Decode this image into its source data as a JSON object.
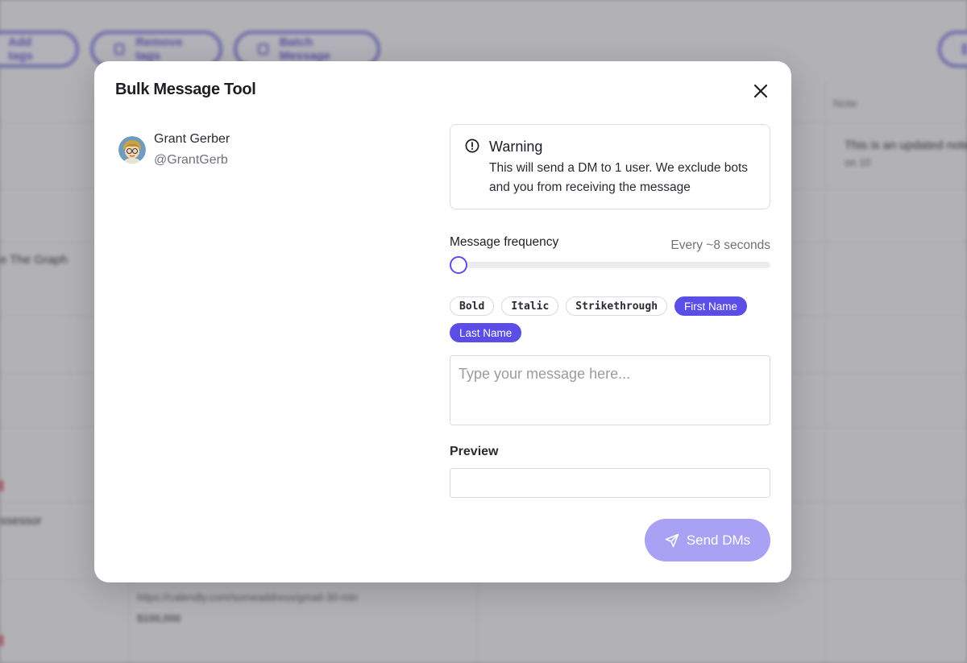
{
  "background": {
    "toolbar": [
      "Add tags",
      "Remove tags",
      "Batch Message"
    ],
    "header_col": "Note",
    "cells": {
      "note_text": "This is an updated note",
      "note_sub": "on 10",
      "row_graph": "e The Graph",
      "row_other": "ssessor",
      "link": "https://calendly.com/someaddress/gmail-30-min",
      "link_sub": "$100,000"
    }
  },
  "modal": {
    "title": "Bulk Message Tool",
    "user": {
      "name": "Grant Gerber",
      "handle": "@GrantGerb"
    },
    "warning": {
      "title": "Warning",
      "body": "This will send a DM to 1 user. We exclude bots and you from receiving the message"
    },
    "frequency": {
      "label": "Message frequency",
      "value_text": "Every ~8 seconds",
      "slider_fraction": 0.0
    },
    "chips": [
      {
        "label": "Bold",
        "style": "plain"
      },
      {
        "label": "Italic",
        "style": "plain"
      },
      {
        "label": "Strikethrough",
        "style": "plain"
      },
      {
        "label": "First Name",
        "style": "accent"
      },
      {
        "label": "Last Name",
        "style": "accent"
      }
    ],
    "message": {
      "value": "",
      "placeholder": "Type your message here..."
    },
    "preview": {
      "label": "Preview",
      "value": ""
    },
    "send_label": "Send DMs"
  },
  "colors": {
    "accent": "#5b4ee6",
    "send_disabled": "#a9a1f3"
  }
}
